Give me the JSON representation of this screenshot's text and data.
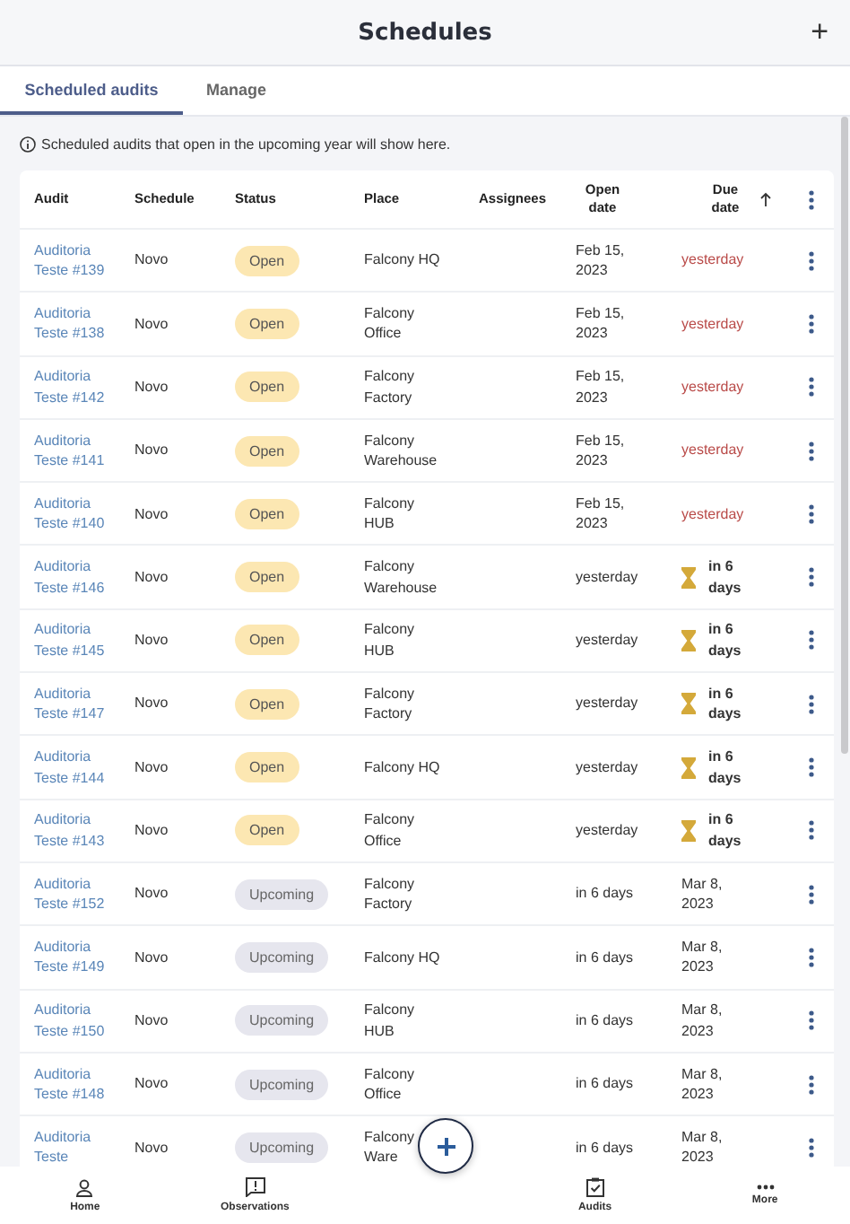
{
  "header": {
    "title": "Schedules",
    "action": "+"
  },
  "tabs": [
    {
      "label": "Scheduled audits",
      "selected": true
    },
    {
      "label": "Manage",
      "selected": false
    }
  ],
  "info": "Scheduled audits that open in the upcoming year will show here.",
  "table": {
    "columns": [
      "Audit",
      "Schedule",
      "Status",
      "Place",
      "Assignees",
      "Open date",
      "Due date"
    ],
    "rows": [
      {
        "audit": "Auditoria Teste #139",
        "schedule": "Novo",
        "status": {
          "label": "Open",
          "kind": "open"
        },
        "place": "Falcony HQ",
        "open": "Feb 15, 2023",
        "due": {
          "label": "yesterday",
          "kind": "overdue"
        }
      },
      {
        "audit": "Auditoria Teste #138",
        "schedule": "Novo",
        "status": {
          "label": "Open",
          "kind": "open"
        },
        "place": "Falcony Office",
        "open": "Feb 15, 2023",
        "due": {
          "label": "yesterday",
          "kind": "overdue"
        }
      },
      {
        "audit": "Auditoria Teste #142",
        "schedule": "Novo",
        "status": {
          "label": "Open",
          "kind": "open"
        },
        "place": "Falcony Factory",
        "open": "Feb 15, 2023",
        "due": {
          "label": "yesterday",
          "kind": "overdue"
        }
      },
      {
        "audit": "Auditoria Teste #141",
        "schedule": "Novo",
        "status": {
          "label": "Open",
          "kind": "open"
        },
        "place": "Falcony Warehouse",
        "open": "Feb 15, 2023",
        "due": {
          "label": "yesterday",
          "kind": "overdue"
        }
      },
      {
        "audit": "Auditoria Teste #140",
        "schedule": "Novo",
        "status": {
          "label": "Open",
          "kind": "open"
        },
        "place": "Falcony HUB",
        "open": "Feb 15, 2023",
        "due": {
          "label": "yesterday",
          "kind": "overdue"
        }
      },
      {
        "audit": "Auditoria Teste #146",
        "schedule": "Novo",
        "status": {
          "label": "Open",
          "kind": "open"
        },
        "place": "Falcony Warehouse",
        "open": "yesterday",
        "due": {
          "label": "in 6 days",
          "kind": "soon"
        }
      },
      {
        "audit": "Auditoria Teste #145",
        "schedule": "Novo",
        "status": {
          "label": "Open",
          "kind": "open"
        },
        "place": "Falcony HUB",
        "open": "yesterday",
        "due": {
          "label": "in 6 days",
          "kind": "soon"
        }
      },
      {
        "audit": "Auditoria Teste #147",
        "schedule": "Novo",
        "status": {
          "label": "Open",
          "kind": "open"
        },
        "place": "Falcony Factory",
        "open": "yesterday",
        "due": {
          "label": "in 6 days",
          "kind": "soon"
        }
      },
      {
        "audit": "Auditoria Teste #144",
        "schedule": "Novo",
        "status": {
          "label": "Open",
          "kind": "open"
        },
        "place": "Falcony HQ",
        "open": "yesterday",
        "due": {
          "label": "in 6 days",
          "kind": "soon"
        }
      },
      {
        "audit": "Auditoria Teste #143",
        "schedule": "Novo",
        "status": {
          "label": "Open",
          "kind": "open"
        },
        "place": "Falcony Office",
        "open": "yesterday",
        "due": {
          "label": "in 6 days",
          "kind": "soon"
        }
      },
      {
        "audit": "Auditoria Teste #152",
        "schedule": "Novo",
        "status": {
          "label": "Upcoming",
          "kind": "upcoming"
        },
        "place": "Falcony Factory",
        "open": "in 6 days",
        "due": {
          "label": "Mar 8, 2023",
          "kind": "date"
        }
      },
      {
        "audit": "Auditoria Teste #149",
        "schedule": "Novo",
        "status": {
          "label": "Upcoming",
          "kind": "upcoming"
        },
        "place": "Falcony HQ",
        "open": "in 6 days",
        "due": {
          "label": "Mar 8, 2023",
          "kind": "date"
        }
      },
      {
        "audit": "Auditoria Teste #150",
        "schedule": "Novo",
        "status": {
          "label": "Upcoming",
          "kind": "upcoming"
        },
        "place": "Falcony HUB",
        "open": "in 6 days",
        "due": {
          "label": "Mar 8, 2023",
          "kind": "date"
        }
      },
      {
        "audit": "Auditoria Teste #148",
        "schedule": "Novo",
        "status": {
          "label": "Upcoming",
          "kind": "upcoming"
        },
        "place": "Falcony Office",
        "open": "in 6 days",
        "due": {
          "label": "Mar 8, 2023",
          "kind": "date"
        }
      },
      {
        "audit": "Auditoria Teste",
        "schedule": "Novo",
        "status": {
          "label": "Upcoming",
          "kind": "upcoming"
        },
        "place": "Falcony Ware",
        "open": "in 6 days",
        "due": {
          "label": "Mar 8, 2023",
          "kind": "date"
        }
      }
    ]
  },
  "nav": [
    {
      "label": "Home",
      "kind": "home"
    },
    {
      "label": "Observations",
      "kind": "observations"
    },
    {
      "label": "Audits",
      "kind": "audits"
    },
    {
      "label": "More",
      "kind": "more"
    }
  ]
}
